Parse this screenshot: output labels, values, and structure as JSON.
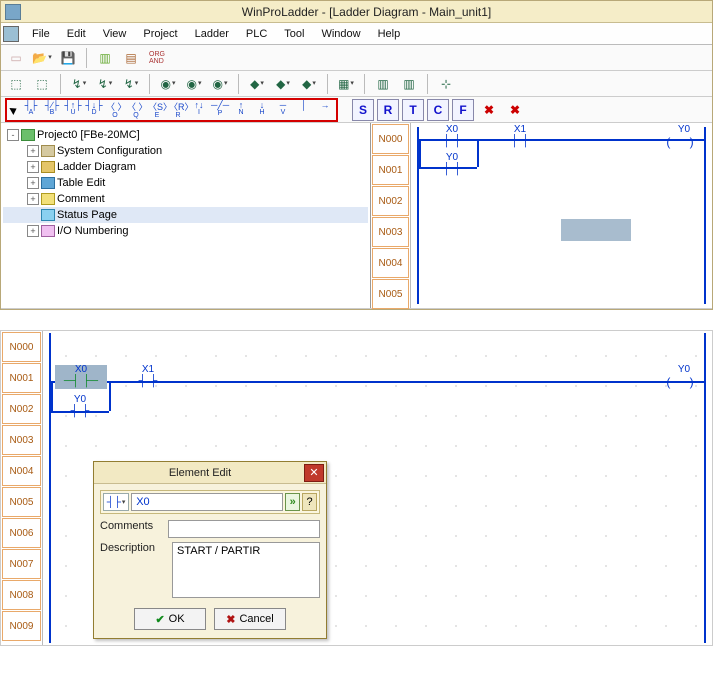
{
  "title": "WinProLadder - [Ladder Diagram - Main_unit1]",
  "menus": [
    "File",
    "Edit",
    "View",
    "Project",
    "Ladder",
    "PLC",
    "Tool",
    "Window",
    "Help"
  ],
  "tree": {
    "root": "Project0 [FBe-20MC]",
    "items": [
      "System Configuration",
      "Ladder Diagram",
      "Table Edit",
      "Comment",
      "Status Page",
      "I/O Numbering"
    ]
  },
  "ladSymbols": [
    {
      "g": "┤├",
      "s": "A"
    },
    {
      "g": "┤∕├",
      "s": "B"
    },
    {
      "g": "┤↑├",
      "s": "U"
    },
    {
      "g": "┤↓├",
      "s": "D"
    },
    {
      "g": "〈 〉",
      "s": "O"
    },
    {
      "g": "〈 〉",
      "s": "Q"
    },
    {
      "g": "〈S〉",
      "s": "E"
    },
    {
      "g": "〈R〉",
      "s": "R"
    },
    {
      "g": "↑↓",
      "s": "I"
    },
    {
      "g": "─╱─",
      "s": "P"
    },
    {
      "g": "↑",
      "s": "N"
    },
    {
      "g": "↓",
      "s": "H"
    },
    {
      "g": "─",
      "s": "V"
    },
    {
      "g": "│",
      "s": " "
    },
    {
      "g": "→",
      "s": " "
    }
  ],
  "coilLetters": [
    "S",
    "R",
    "T",
    "C",
    "F"
  ],
  "rungsTop": [
    "N000",
    "N001",
    "N002",
    "N003",
    "N004",
    "N005"
  ],
  "rungsDetail": [
    "N000",
    "N001",
    "N002",
    "N003",
    "N004",
    "N005",
    "N006",
    "N007",
    "N008",
    "N009"
  ],
  "elements": {
    "x0": "X0",
    "x1": "X1",
    "y0": "Y0"
  },
  "dialog": {
    "title": "Element Edit",
    "addr": "X0",
    "comments_label": "Comments",
    "comments_value": "",
    "desc_label": "Description",
    "desc_value": "START / PARTIR",
    "ok": "OK",
    "cancel": "Cancel"
  },
  "toolbarText": {
    "org_and": "ORG\nAND"
  }
}
